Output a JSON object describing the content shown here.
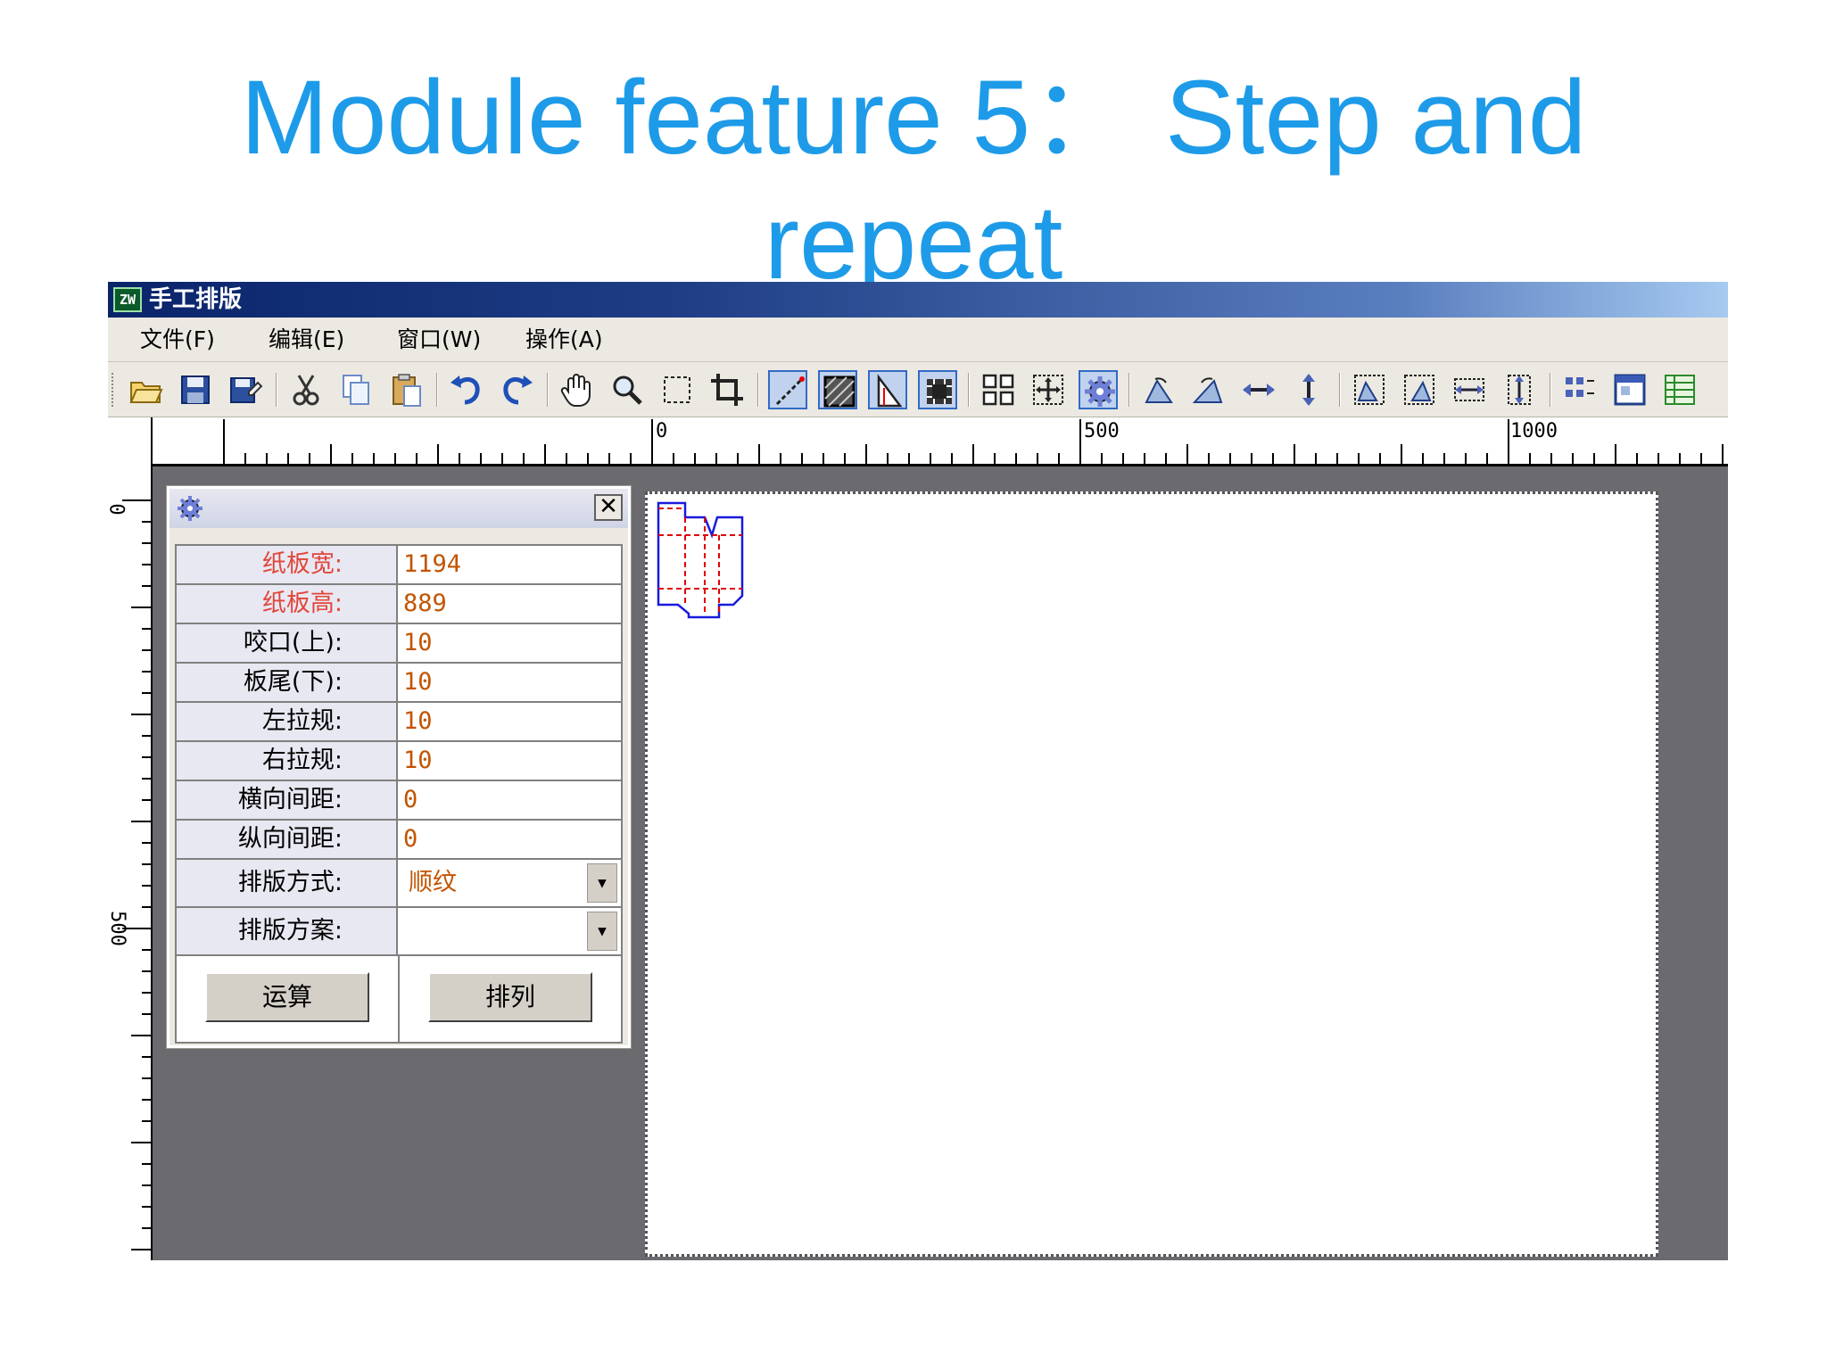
{
  "slide": {
    "title_line1": "Module feature 5： Step and",
    "title_line2": "repeat"
  },
  "window": {
    "icon_text": "ZW",
    "title": "手工排版"
  },
  "menu": [
    {
      "label": "文件(F)"
    },
    {
      "label": "编辑(E)"
    },
    {
      "label": "窗口(W)"
    },
    {
      "label": "操作(A)"
    }
  ],
  "toolbar": {
    "icons": [
      "open-folder-icon",
      "save-icon",
      "save-as-icon",
      "cut-icon",
      "copy-icon",
      "paste-icon",
      "undo-icon",
      "redo-icon",
      "hand-pan-icon",
      "zoom-icon",
      "select-rect-icon",
      "crop-icon",
      "line-tool-icon",
      "hatch-fill-icon",
      "trapezoid-icon",
      "grid-pattern-icon",
      "tile-layout-icon",
      "fit-view-icon",
      "settings-gear-icon",
      "rotate-left-icon",
      "rotate-right-icon",
      "flip-horizontal-icon",
      "flip-vertical-icon",
      "align-left-icon",
      "align-right-icon",
      "distribute-h-icon",
      "distribute-v-icon",
      "array-icon",
      "window-icon",
      "table-icon"
    ],
    "active": [
      "line-tool-icon",
      "hatch-fill-icon",
      "trapezoid-icon",
      "grid-pattern-icon",
      "settings-gear-icon"
    ]
  },
  "ruler": {
    "top_labels": [
      "0",
      "500",
      "1000"
    ],
    "left_labels": [
      "0",
      "500"
    ]
  },
  "panel": {
    "close_symbol": "✕",
    "rows": [
      {
        "label": "纸板宽:",
        "value": "1194",
        "required": true
      },
      {
        "label": "纸板高:",
        "value": "889",
        "required": true
      },
      {
        "label": "咬口(上):",
        "value": "10",
        "required": false
      },
      {
        "label": "板尾(下):",
        "value": "10",
        "required": false
      },
      {
        "label": "左拉规:",
        "value": "10",
        "required": false
      },
      {
        "label": "右拉规:",
        "value": "10",
        "required": false
      },
      {
        "label": "横向间距:",
        "value": "0",
        "required": false
      },
      {
        "label": "纵向间距:",
        "value": "0",
        "required": false
      }
    ],
    "layout_mode": {
      "label": "排版方式:",
      "value": "顺纹"
    },
    "layout_plan": {
      "label": "排版方案:",
      "value": ""
    },
    "calc_button": "运算",
    "arrange_button": "排列"
  },
  "colors": {
    "title_blue": "#1e9be8",
    "titlebar_dark": "#0a246a",
    "workspace_gray": "#6b6a6f",
    "required_label_red": "#e2463a",
    "value_orange": "#c25400",
    "dieline_blue": "#1a1adc",
    "dieline_fold_red": "#e00000"
  }
}
